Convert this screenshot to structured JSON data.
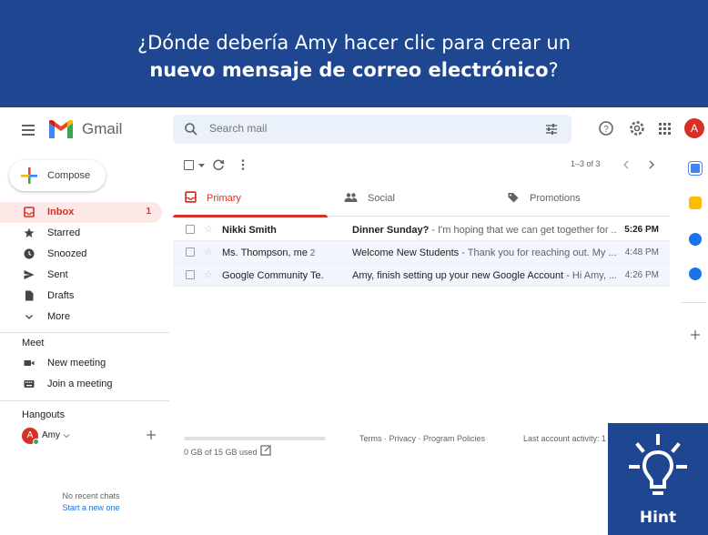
{
  "banner": {
    "line1": "¿Dónde debería Amy hacer clic para crear un",
    "line2_bold": "nuevo mensaje de correo electrónico",
    "line2_end": "?"
  },
  "header": {
    "app_name": "Gmail",
    "search_placeholder": "Search mail",
    "avatar_letter": "A",
    "icons": [
      "menu-icon",
      "search-icon",
      "tune-icon",
      "help-icon",
      "settings-icon",
      "apps-icon"
    ]
  },
  "compose_label": "Compose",
  "nav": [
    {
      "label": "Inbox",
      "count": "1",
      "icon": "inbox-icon"
    },
    {
      "label": "Starred",
      "count": "",
      "icon": "star-icon"
    },
    {
      "label": "Snoozed",
      "count": "",
      "icon": "clock-icon"
    },
    {
      "label": "Sent",
      "count": "",
      "icon": "send-icon"
    },
    {
      "label": "Drafts",
      "count": "",
      "icon": "draft-icon"
    },
    {
      "label": "More",
      "count": "",
      "icon": "chevron-down-icon"
    }
  ],
  "meet": {
    "title": "Meet",
    "items": [
      {
        "label": "New meeting",
        "icon": "video-icon"
      },
      {
        "label": "Join a meeting",
        "icon": "keyboard-icon"
      }
    ]
  },
  "hangouts": {
    "title": "Hangouts",
    "user": "Amy",
    "user_initial": "A",
    "no_chats": "No recent chats",
    "start_chat": "Start a new one"
  },
  "toolbar": {
    "pagination": "1–3 of 3"
  },
  "tabs": [
    {
      "label": "Primary"
    },
    {
      "label": "Social"
    },
    {
      "label": "Promotions"
    }
  ],
  "emails": [
    {
      "sender": "Nikki Smith",
      "sender_count": "",
      "subject": "Dinner Sunday?",
      "snippet": " - I'm hoping that we can get together for ...",
      "time": "5:26 PM",
      "unread": true
    },
    {
      "sender": "Ms. Thompson, me",
      "sender_count": " 2",
      "subject": "Welcome New Students",
      "snippet": " - Thank you for reaching out. My ...",
      "time": "4:48 PM",
      "unread": false
    },
    {
      "sender": "Google Community Te.",
      "sender_count": "",
      "subject": "Amy, finish setting up your new Google Account",
      "snippet": " - Hi Amy, ...",
      "time": "4:26 PM",
      "unread": false
    }
  ],
  "footer": {
    "storage": "0 GB of 15 GB used",
    "links": "Terms · Privacy · Program Policies",
    "activity": "Last account activity: 1"
  },
  "hint_label": "Hint",
  "colors": {
    "banner": "#1f4690",
    "accent_red": "#d93025",
    "inbox_highlight": "#fce8e6"
  }
}
